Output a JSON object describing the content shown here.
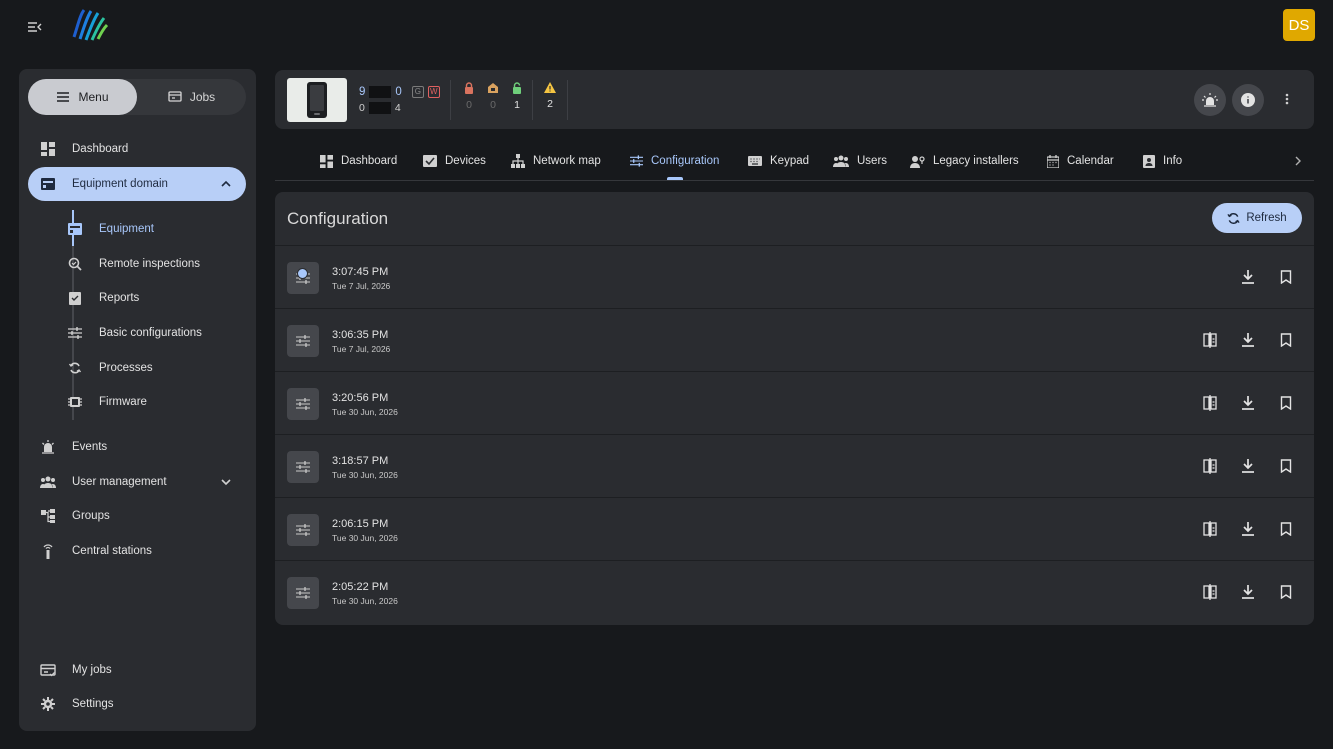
{
  "user": {
    "initials": "DS",
    "avatar_color": "#e0a800"
  },
  "sidebar": {
    "segment": {
      "menu_label": "Menu",
      "jobs_label": "Jobs",
      "active": "Menu"
    },
    "items": [
      {
        "label": "Dashboard",
        "icon": "dashboard-icon"
      },
      {
        "label": "Equipment domain",
        "icon": "equipment-icon",
        "expanded": true
      },
      {
        "label": "Events",
        "icon": "alarm-icon"
      },
      {
        "label": "User management",
        "icon": "users-icon"
      },
      {
        "label": "Groups",
        "icon": "groups-icon"
      },
      {
        "label": "Central stations",
        "icon": "antenna-icon"
      }
    ],
    "subitems": [
      {
        "label": "Equipment",
        "icon": "equipment-icon",
        "active": true
      },
      {
        "label": "Remote inspections",
        "icon": "inspection-icon"
      },
      {
        "label": "Reports",
        "icon": "report-icon"
      },
      {
        "label": "Basic configurations",
        "icon": "tune-icon"
      },
      {
        "label": "Processes",
        "icon": "sync-icon"
      },
      {
        "label": "Firmware",
        "icon": "chip-icon"
      }
    ],
    "bottom": [
      {
        "label": "My jobs",
        "icon": "jobs-icon"
      },
      {
        "label": "Settings",
        "icon": "gear-icon"
      }
    ]
  },
  "device": {
    "id_line1_a": "9",
    "id_line1_b": "0",
    "id_line2_a": "0",
    "id_line2_b": "4",
    "badge_g": "G",
    "badge_w": "W",
    "stats": [
      {
        "icon": "lock-icon",
        "value": "0",
        "color": "#d9735f"
      },
      {
        "icon": "home-lock-icon",
        "value": "0",
        "color": "#d9a25f"
      },
      {
        "icon": "unlock-icon",
        "value": "1",
        "color": "#6fcf7b"
      }
    ],
    "warning": {
      "icon": "warning-icon",
      "value": "2",
      "color": "#f5c542"
    }
  },
  "tabs": [
    {
      "label": "Dashboard",
      "icon": "dashboard-icon"
    },
    {
      "label": "Devices",
      "icon": "devices-icon"
    },
    {
      "label": "Network map",
      "icon": "network-icon"
    },
    {
      "label": "Configuration",
      "icon": "tune-icon",
      "active": true
    },
    {
      "label": "Keypad",
      "icon": "keypad-icon"
    },
    {
      "label": "Users",
      "icon": "users-icon"
    },
    {
      "label": "Legacy installers",
      "icon": "installer-icon"
    },
    {
      "label": "Calendar",
      "icon": "calendar-icon"
    },
    {
      "label": "Info",
      "icon": "info-card-icon"
    }
  ],
  "panel": {
    "title": "Configuration",
    "refresh_label": "Refresh",
    "rows": [
      {
        "time": "3:07:45 PM",
        "date": "Tue 7 Jul, 2026",
        "current": true,
        "compare": false
      },
      {
        "time": "3:06:35 PM",
        "date": "Tue 7 Jul, 2026",
        "current": false,
        "compare": true
      },
      {
        "time": "3:20:56 PM",
        "date": "Tue 30 Jun, 2026",
        "current": false,
        "compare": true
      },
      {
        "time": "3:18:57 PM",
        "date": "Tue 30 Jun, 2026",
        "current": false,
        "compare": true
      },
      {
        "time": "2:06:15 PM",
        "date": "Tue 30 Jun, 2026",
        "current": false,
        "compare": true
      },
      {
        "time": "2:05:22 PM",
        "date": "Tue 30 Jun, 2026",
        "current": false,
        "compare": true
      }
    ]
  },
  "colors": {
    "accent": "#a8c7fa",
    "accent_bg": "#b8cff7",
    "surface": "#2a2c30",
    "background": "#17191c"
  }
}
